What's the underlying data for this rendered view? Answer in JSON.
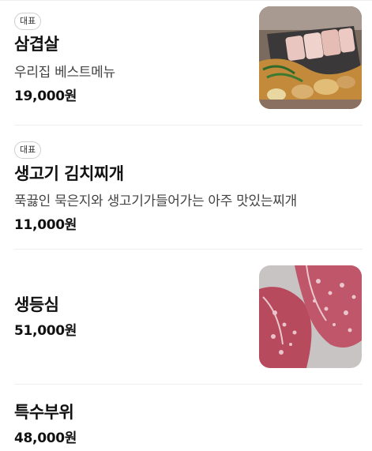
{
  "menu": {
    "items": [
      {
        "badge": "대표",
        "name": "삼겹살",
        "description": "우리집 베스트메뉴",
        "price": "19,000원",
        "image": "grilled-pork-belly-photo"
      },
      {
        "badge": "대표",
        "name": "생고기 김치찌개",
        "description": "푹끓인 묵은지와 생고기가들어가는 아주 맛있는찌개",
        "price": "11,000원"
      },
      {
        "name": "생등심",
        "price": "51,000원",
        "image": "raw-beef-sirloin-photo"
      },
      {
        "name": "특수부위",
        "price": "48,000원"
      }
    ]
  }
}
